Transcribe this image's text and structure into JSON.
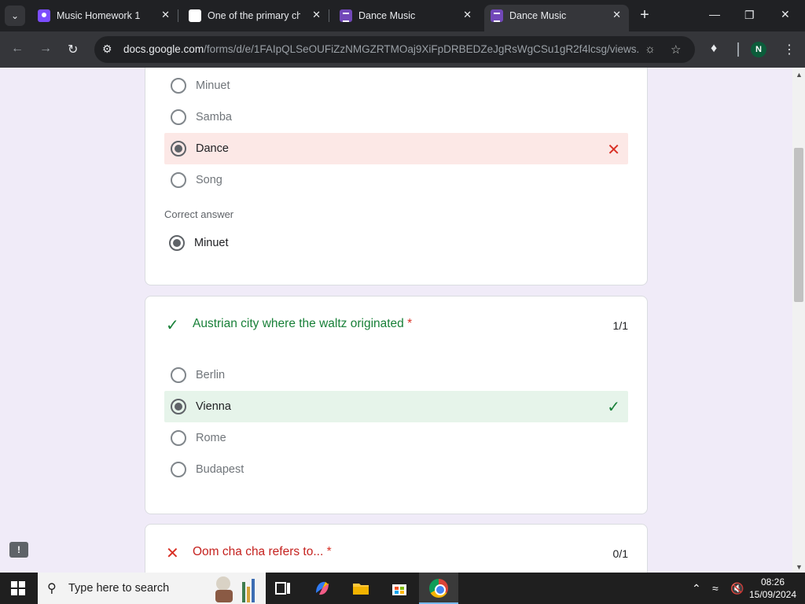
{
  "browser": {
    "tabs": [
      {
        "title": "Music Homework 1",
        "icon": "classroom-icon",
        "active": false
      },
      {
        "title": "One of the primary ch",
        "icon": "google-icon",
        "active": false
      },
      {
        "title": "Dance Music",
        "icon": "forms-icon",
        "active": false
      },
      {
        "title": "Dance Music",
        "icon": "forms-icon",
        "active": true
      }
    ],
    "url_domain": "docs.google.com",
    "url_path": "/forms/d/e/1FAIpQLSeOUFiZzNMGZRTMOaj9XiFpDRBEDZeJgRsWgCSu1gR2f4lcsg/views...",
    "profile_initial": "N"
  },
  "quiz": {
    "q1": {
      "options": [
        {
          "label": "Minuet",
          "state": "unselected"
        },
        {
          "label": "Samba",
          "state": "unselected"
        },
        {
          "label": "Dance",
          "state": "selected-wrong"
        },
        {
          "label": "Song",
          "state": "unselected"
        }
      ],
      "correct_heading": "Correct answer",
      "correct_answer": "Minuet"
    },
    "q2": {
      "title": "Austrian city where the waltz originated",
      "required_mark": "*",
      "score": "1/1",
      "result": "correct",
      "options": [
        {
          "label": "Berlin",
          "state": "unselected"
        },
        {
          "label": "Vienna",
          "state": "selected-correct"
        },
        {
          "label": "Rome",
          "state": "unselected"
        },
        {
          "label": "Budapest",
          "state": "unselected"
        }
      ]
    },
    "q3": {
      "title": "Oom cha cha refers to...",
      "required_mark": "*",
      "score": "0/1",
      "result": "incorrect"
    }
  },
  "taskbar": {
    "search_placeholder": "Type here to search",
    "time": "08:26",
    "date": "15/09/2024"
  },
  "colors": {
    "page_bg": "#f0ebf8",
    "wrong_bg": "#fce8e6",
    "right_bg": "#e6f4ea",
    "wrong_accent": "#d93025",
    "right_accent": "#188038"
  }
}
